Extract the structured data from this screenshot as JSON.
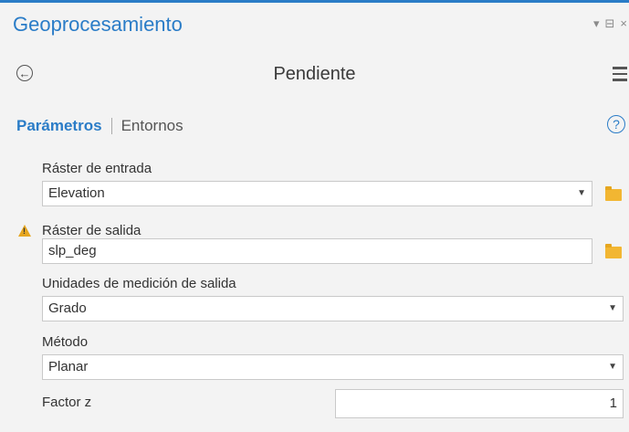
{
  "pane": {
    "title": "Geoprocesamiento",
    "controls": [
      "▾",
      "⊟",
      "×"
    ]
  },
  "tool": {
    "title": "Pendiente",
    "back_icon": "back-arrow-icon",
    "menu_icon": "hamburger-menu-icon"
  },
  "tabs": {
    "active": "Parámetros",
    "inactive": "Entornos",
    "help_glyph": "?"
  },
  "params": {
    "input_raster": {
      "label": "Ráster de entrada",
      "value": "Elevation"
    },
    "output_raster": {
      "label": "Ráster de salida",
      "value": "slp_deg",
      "warning": true
    },
    "output_units": {
      "label": "Unidades de medición de salida",
      "value": "Grado"
    },
    "method": {
      "label": "Método",
      "value": "Planar"
    },
    "z_factor": {
      "label": "Factor z",
      "value": "1"
    }
  },
  "colors": {
    "accent": "#2a7cc7",
    "warning": "#e6a61f",
    "folder": "#f2b632"
  }
}
